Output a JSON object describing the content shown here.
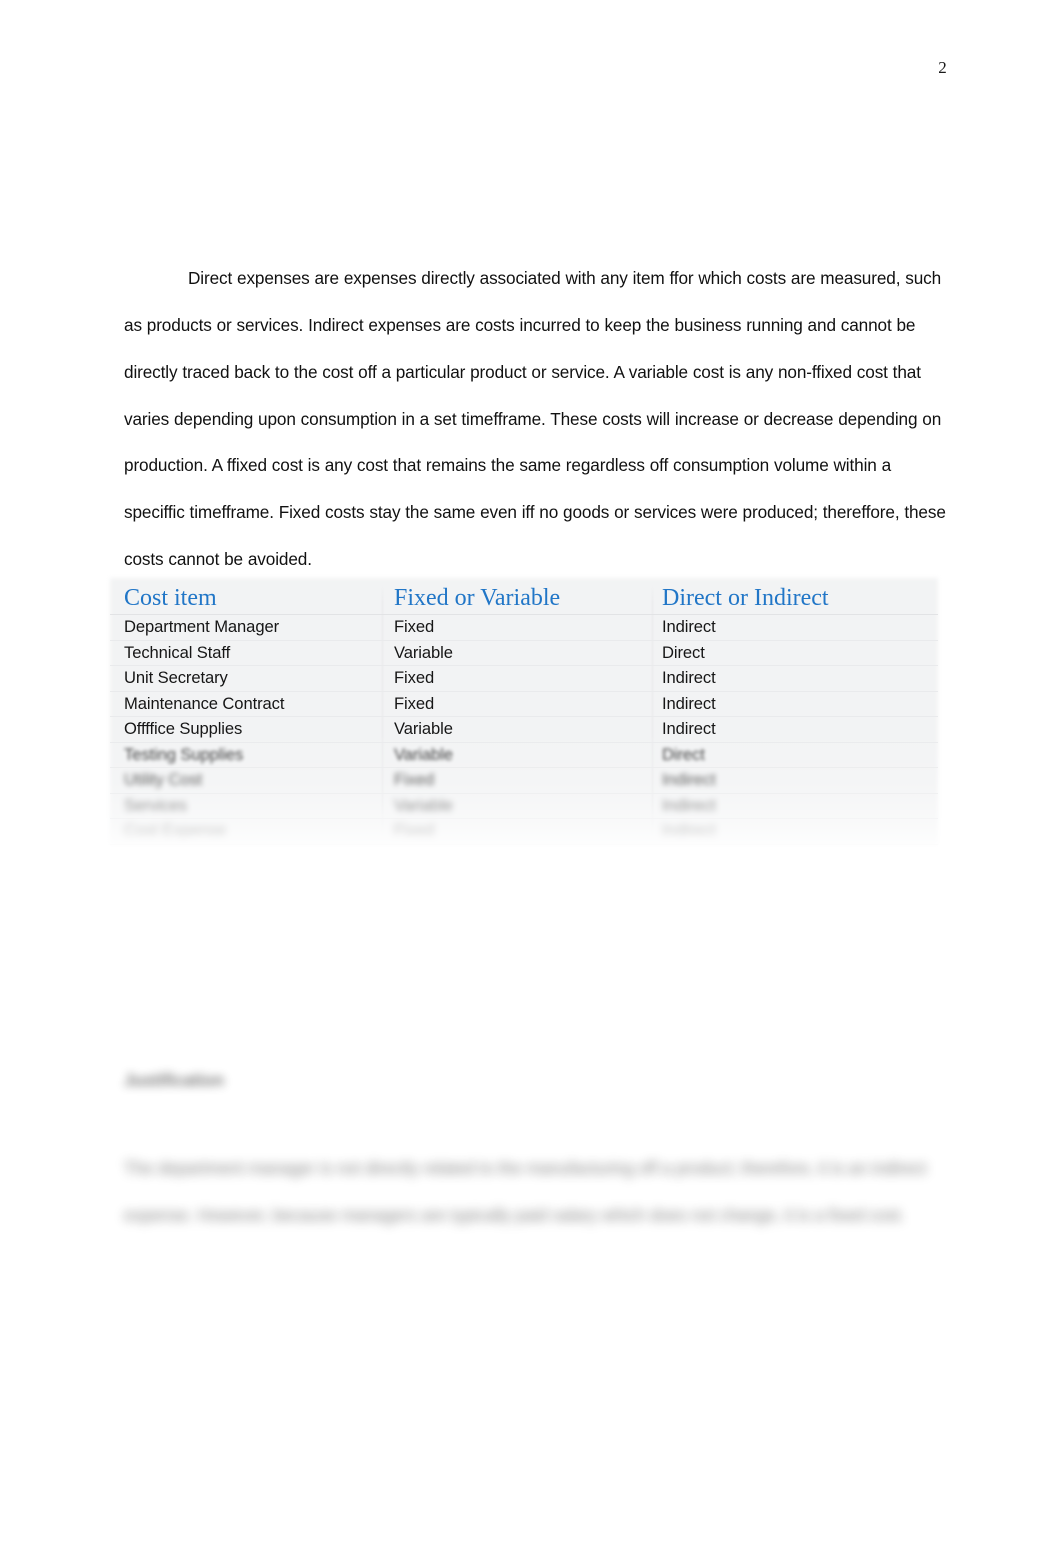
{
  "document": {
    "page_number": "2",
    "body_paragraph": "Direct expenses are expenses directly associated with any item ffor which costs are measured, such as products or services. Indirect expenses are costs incurred to keep the business running and cannot be directly traced back to the cost off a particular product or service. A variable cost is any non-ffixed cost that varies depending upon consumption in a set timefframe. These costs will increase or decrease depending on production. A ffixed cost is any cost that remains the same regardless off consumption volume within a speciffic timefframe. Fixed costs stay the same even iff no goods or services were produced; thereffore, these costs cannot be avoided."
  },
  "cost_table": {
    "headers": {
      "col1": "Cost item",
      "col2": "Fixed or Variable",
      "col3": "Direct or Indirect"
    },
    "header_color": "#2176c7",
    "rows": [
      {
        "cost_item": "Department Manager",
        "fixed_or_variable": "Fixed",
        "direct_or_indirect": "Indirect",
        "blur_level": 0
      },
      {
        "cost_item": "Technical Staff",
        "fixed_or_variable": "Variable",
        "direct_or_indirect": "Direct",
        "blur_level": 0
      },
      {
        "cost_item": "Unit Secretary",
        "fixed_or_variable": "Fixed",
        "direct_or_indirect": "Indirect",
        "blur_level": 0
      },
      {
        "cost_item": "Maintenance Contract",
        "fixed_or_variable": "Fixed",
        "direct_or_indirect": "Indirect",
        "blur_level": 0
      },
      {
        "cost_item": "Offffice Supplies",
        "fixed_or_variable": "Variable",
        "direct_or_indirect": "Indirect",
        "blur_level": 0
      },
      {
        "cost_item": "Testing Supplies",
        "fixed_or_variable": "Variable",
        "direct_or_indirect": "Direct",
        "blur_level": 1
      },
      {
        "cost_item": "Utility Cost",
        "fixed_or_variable": "Fixed",
        "direct_or_indirect": "Indirect",
        "blur_level": 2
      },
      {
        "cost_item": "Services",
        "fixed_or_variable": "Variable",
        "direct_or_indirect": "Indirect",
        "blur_level": 3
      },
      {
        "cost_item": "Cost Expense",
        "fixed_or_variable": "Fixed",
        "direct_or_indirect": "Indirect",
        "blur_level": 4
      }
    ]
  },
  "lower_section": {
    "heading": "Justification",
    "paragraph": "The department manager is not directly related to the manufacturing off a product; therefore, it is an indirect expense. However, because managers are typically paid salary which does not change, it is a fixed cost."
  }
}
